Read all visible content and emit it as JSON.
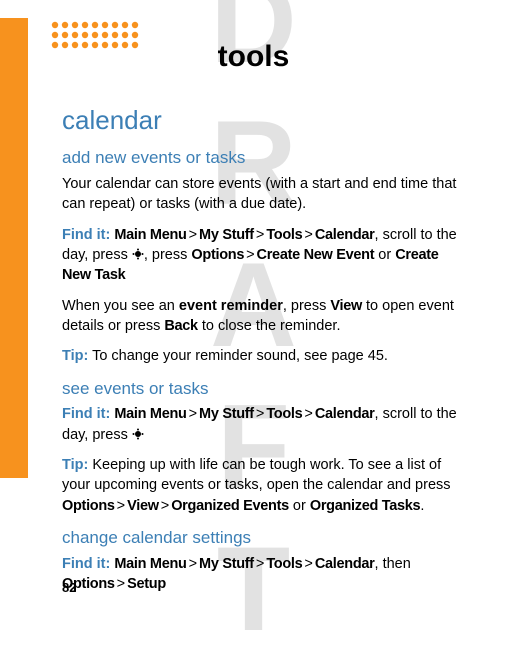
{
  "watermark": "DRAFT",
  "page_title": "tools",
  "page_number": "82",
  "labels": {
    "find_it": "Find it:",
    "tip": "Tip:"
  },
  "menu": {
    "main": "Main Menu",
    "mystuff": "My Stuff",
    "tools": "Tools",
    "calendar": "Calendar",
    "options": "Options",
    "create_event": "Create New Event",
    "create_task": "Create New Task",
    "view": "View",
    "back": "Back",
    "org_events": "Organized Events",
    "org_tasks": "Organized Tasks",
    "setup": "Setup"
  },
  "sections": {
    "calendar": {
      "heading": "calendar",
      "add_events": {
        "heading": "add new events or tasks",
        "body": "Your calendar can store events (with a start and end time that can repeat) or tasks (with a due date).",
        "scroll_day": ", scroll to the day, press ",
        "press_opts": ", press ",
        "or": " or ",
        "reminder1": "When you see an ",
        "event_reminder": "event reminder",
        "reminder2": ", press ",
        "reminder3": " to open event details or press ",
        "reminder4": " to close the reminder.",
        "tip_body": " To change your reminder sound, see page 45."
      },
      "see_events": {
        "heading": "see events or tasks",
        "scroll_day": ", scroll to the day, press ",
        "tip_body": " Keeping up with life can be tough work. To see a list of your upcoming events or tasks, open the calendar and press ",
        "and": " or ",
        "period": "."
      },
      "change_settings": {
        "heading": "change calendar settings",
        "then": ", then"
      }
    }
  }
}
